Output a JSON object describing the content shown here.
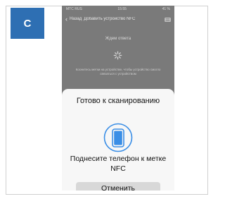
{
  "figure_label": "C",
  "status_bar": {
    "carrier": "МТС RUS",
    "time": "15:55",
    "battery": "41 %"
  },
  "nav": {
    "back_label": "Назад",
    "title": "Добавить устройство NFC",
    "icon": "share-icon"
  },
  "background": {
    "heading": "Ждем ответа",
    "description": "Коснитесь метки на устройстве, чтобы устройство смогло связаться с устройством"
  },
  "sheet": {
    "title": "Готово к сканированию",
    "icon": "phone-icon",
    "message": "Поднесите телефон к метке NFC",
    "cancel_label": "Отменить"
  },
  "colors": {
    "accent": "#2e6fb3",
    "sheet": "#f7f7f7",
    "overlay": "#7a7a7a"
  }
}
